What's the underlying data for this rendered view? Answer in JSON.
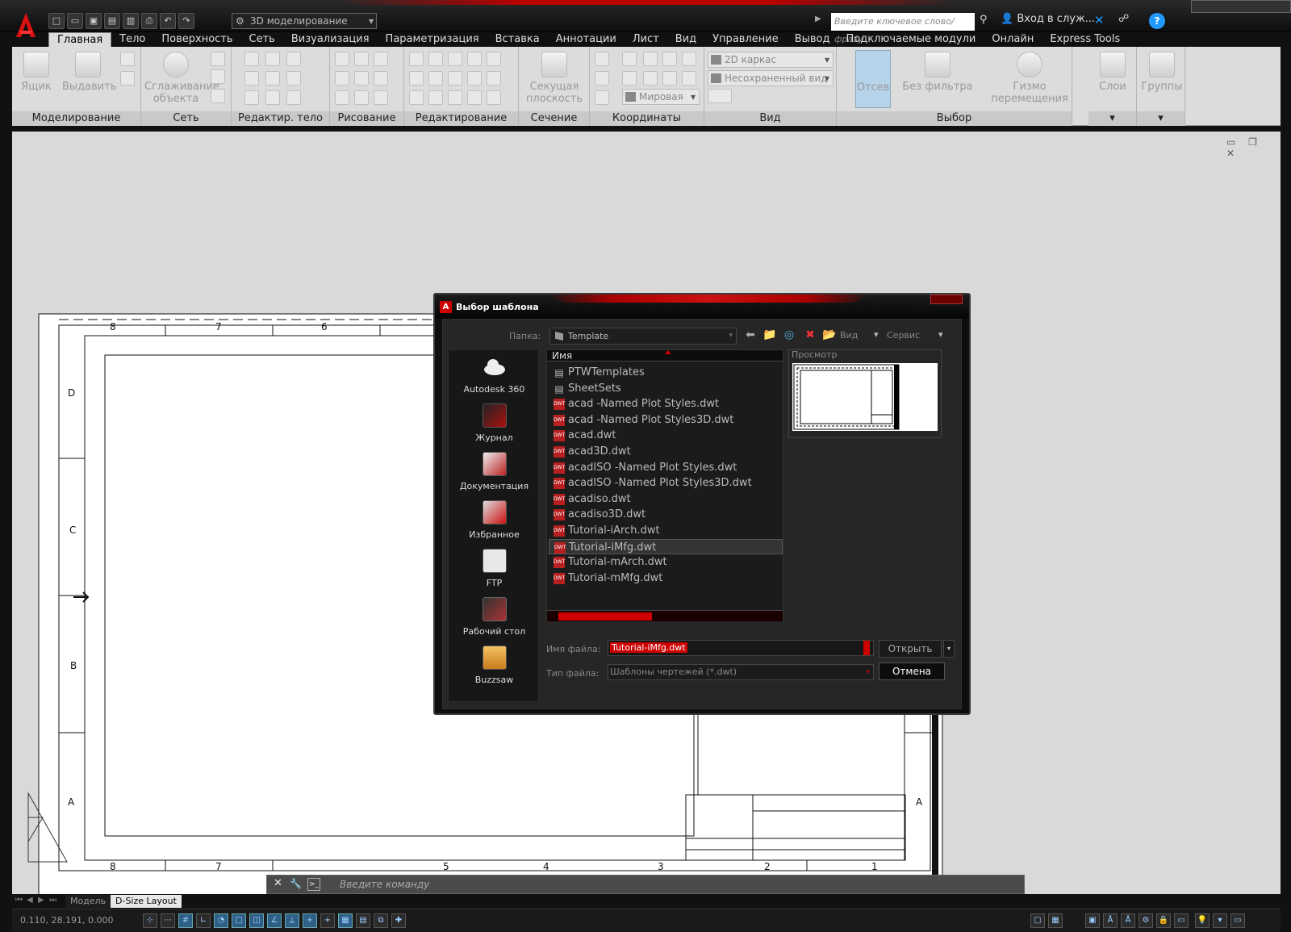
{
  "titlebar": {
    "workspace": "3D моделирование",
    "search_placeholder": "Введите ключевое слово/фразу",
    "signin": "Вход в служ...",
    "help": "?"
  },
  "tabs": [
    "Главная",
    "Тело",
    "Поверхность",
    "Сеть",
    "Визуализация",
    "Параметризация",
    "Вставка",
    "Аннотации",
    "Лист",
    "Вид",
    "Управление",
    "Вывод",
    "Подключаемые модули",
    "Онлайн",
    "Express Tools"
  ],
  "ribbon": {
    "box": "Ящик",
    "extrude": "Выдавить",
    "smooth_line1": "Сглаживание",
    "smooth_line2": "объекта",
    "section_line1": "Секущая",
    "section_line2": "плоскость",
    "visual_style": "2D каркас",
    "view_name": "Несохраненный вид",
    "ucs": "Мировая",
    "culling": "Отсев",
    "no_filter": "Без фильтра",
    "gizmo": "Гизмо перемещения",
    "layers": "Слои",
    "groups": "Группы",
    "panels": [
      "Моделирование",
      "Сеть",
      "Редактир. тело",
      "Рисование",
      "Редактирование",
      "Сечение",
      "Координаты",
      "Вид",
      "Выбор"
    ]
  },
  "drawing": {
    "top_numbers": [
      "8",
      "7",
      "6"
    ],
    "bottom_numbers": [
      "8",
      "7",
      "5",
      "4",
      "3",
      "2",
      "1"
    ],
    "left_letters": [
      "D",
      "C",
      "B",
      "A"
    ],
    "right_letters": [
      "A"
    ]
  },
  "cmdline": {
    "placeholder": "Введите команду"
  },
  "layout_tabs": [
    "Модель",
    "D-Size Layout"
  ],
  "status": {
    "coords": "0.110, 28.191, 0.000"
  },
  "dialog": {
    "title": "Выбор шаблона",
    "folder_label": "Папка:",
    "folder": "Template",
    "view_menu": "Вид",
    "service_menu": "Сервис",
    "places": [
      "Autodesk 360",
      "Журнал",
      "Документация",
      "Избранное",
      "FTP",
      "Рабочий стол",
      "Buzzsaw"
    ],
    "col_name": "Имя",
    "files": [
      {
        "name": "PTWTemplates",
        "type": "folder"
      },
      {
        "name": "SheetSets",
        "type": "folder"
      },
      {
        "name": "acad -Named Plot Styles.dwt",
        "type": "dwt"
      },
      {
        "name": "acad -Named Plot Styles3D.dwt",
        "type": "dwt"
      },
      {
        "name": "acad.dwt",
        "type": "dwt"
      },
      {
        "name": "acad3D.dwt",
        "type": "dwt"
      },
      {
        "name": "acadISO -Named Plot Styles.dwt",
        "type": "dwt"
      },
      {
        "name": "acadISO -Named Plot Styles3D.dwt",
        "type": "dwt"
      },
      {
        "name": "acadiso.dwt",
        "type": "dwt"
      },
      {
        "name": "acadiso3D.dwt",
        "type": "dwt"
      },
      {
        "name": "Tutorial-iArch.dwt",
        "type": "dwt"
      },
      {
        "name": "Tutorial-iMfg.dwt",
        "type": "dwt",
        "selected": true
      },
      {
        "name": "Tutorial-mArch.dwt",
        "type": "dwt"
      },
      {
        "name": "Tutorial-mMfg.dwt",
        "type": "dwt"
      }
    ],
    "preview_label": "Просмотр",
    "filename_label": "Имя файла:",
    "filename": "Tutorial-iMfg.dwt",
    "filetype_label": "Тип файла:",
    "filetype": "Шаблоны чертежей (*.dwt)",
    "open": "Открыть",
    "cancel": "Отмена"
  }
}
